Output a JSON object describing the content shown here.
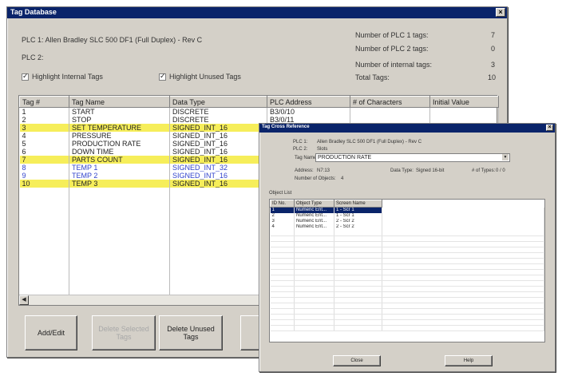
{
  "main_window": {
    "title": "Tag Database",
    "plc1_line": "PLC 1: Allen Bradley SLC 500 DF1 (Full Duplex) - Rev C",
    "plc2_line": "PLC 2:",
    "counts": [
      {
        "label": "Number of PLC 1 tags:",
        "value": "7"
      },
      {
        "label": "Number of PLC 2 tags:",
        "value": "0"
      },
      {
        "label": "Number of internal tags:",
        "value": "3"
      },
      {
        "label": "Total Tags:",
        "value": "10"
      }
    ],
    "checkbox_internal": "Highlight Internal Tags",
    "checkbox_unused": "Highlight Unused Tags",
    "columns": [
      "Tag #",
      "Tag Name",
      "Data Type",
      "PLC Address",
      "# of Characters",
      "Initial Value"
    ],
    "rows": [
      {
        "num": "1",
        "name": "START",
        "type": "DISCRETE",
        "addr": "B3/0/10",
        "style": ""
      },
      {
        "num": "2",
        "name": "STOP",
        "type": "DISCRETE",
        "addr": "B3/0/11",
        "style": ""
      },
      {
        "num": "3",
        "name": "SET TEMPERATURE",
        "type": "SIGNED_INT_16",
        "addr": "",
        "style": "hl"
      },
      {
        "num": "4",
        "name": "PRESSURE",
        "type": "SIGNED_INT_16",
        "addr": "",
        "style": ""
      },
      {
        "num": "5",
        "name": "PRODUCTION RATE",
        "type": "SIGNED_INT_16",
        "addr": "",
        "style": ""
      },
      {
        "num": "6",
        "name": "DOWN TIME",
        "type": "SIGNED_INT_16",
        "addr": "",
        "style": ""
      },
      {
        "num": "7",
        "name": "PARTS COUNT",
        "type": "SIGNED_INT_16",
        "addr": "",
        "style": "hl"
      },
      {
        "num": "8",
        "name": "TEMP 1",
        "type": "SIGNED_INT_32",
        "addr": "",
        "style": "blue"
      },
      {
        "num": "9",
        "name": "TEMP 2",
        "type": "SIGNED_INT_16",
        "addr": "",
        "style": "blue"
      },
      {
        "num": "10",
        "name": "TEMP 3",
        "type": "SIGNED_INT_16",
        "addr": "",
        "style": "hl"
      }
    ],
    "buttons": {
      "add_edit": "Add/Edit",
      "delete_selected": "Delete Selected Tags",
      "delete_unused": "Delete Unused Tags"
    }
  },
  "xref_window": {
    "title": "Tag Cross Reference",
    "plc1_label": "PLC 1:",
    "plc1_value": "Allen Bradley SLC 500 DF1 (Full Duplex) - Rev C",
    "plc2_label": "PLC 2:",
    "plc2_value": "Slots",
    "tagname_label": "Tag Name:",
    "tagname_value": "PRODUCTION RATE",
    "address_label": "Address:",
    "address_value": "N7:13",
    "datatype_label": "Data Type:",
    "datatype_value": "Signed 16-bit",
    "ntypes_label": "# of Types:",
    "ntypes_value": "0 / 0",
    "num_objects_label": "Number of Objects:",
    "num_objects_value": "4",
    "object_list_label": "Object List",
    "columns": [
      "ID No.",
      "Object Type",
      "Screen Name"
    ],
    "rows": [
      {
        "id": "1",
        "type": "Numeric Ent...",
        "screen": "1 - Scr 1",
        "sel": true
      },
      {
        "id": "2",
        "type": "Numeric Ent...",
        "screen": "1 - Scr 1",
        "sel": false
      },
      {
        "id": "3",
        "type": "Numeric Ent...",
        "screen": "2 - Scr 2",
        "sel": false
      },
      {
        "id": "4",
        "type": "Numeric Ent...",
        "screen": "2 - Scr 2",
        "sel": false
      }
    ],
    "close_label": "Close",
    "help_label": "Help"
  },
  "colors": {
    "titlebar": "#0a246a",
    "highlight_row": "#f6ee5a",
    "unused_text": "#3344cc"
  }
}
